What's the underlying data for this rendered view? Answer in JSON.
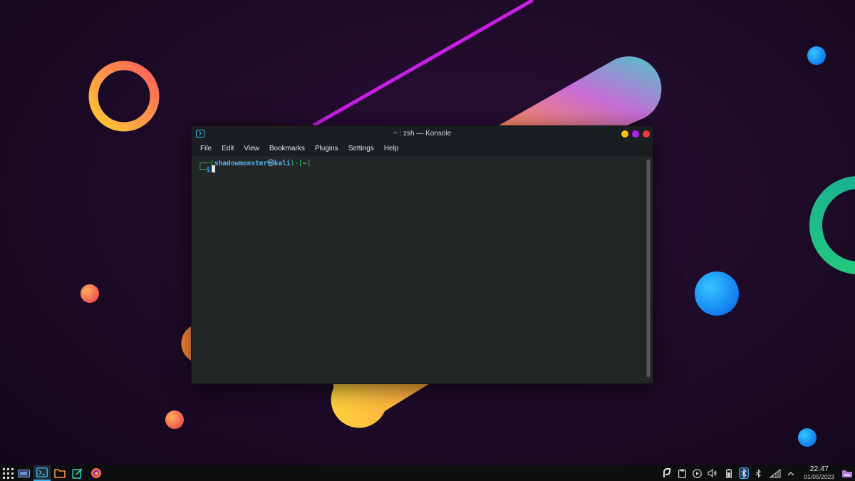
{
  "window": {
    "title": "~ : zsh — Konsole",
    "menu": [
      "File",
      "Edit",
      "View",
      "Bookmarks",
      "Plugins",
      "Settings",
      "Help"
    ]
  },
  "terminal": {
    "line1_prefix": "┌──(",
    "user": "shadowmonster",
    "at": "㉿",
    "host": "kali",
    "line1_mid": ")-[",
    "cwd": "~",
    "line1_end": "]",
    "line2_prefix": "└─",
    "prompt": "$"
  },
  "taskbar": {
    "icons": [
      "app-launcher-icon",
      "desktop-pager-icon",
      "konsole-icon",
      "file-manager-icon",
      "text-editor-icon",
      "firefox-icon"
    ],
    "tray_icons": [
      "vpn-icon",
      "clipboard-icon",
      "media-player-icon",
      "volume-icon",
      "battery-icon",
      "bluetooth-icon",
      "bluetooth-off-icon",
      "network-icon",
      "expand-tray-icon",
      "show-desktop-icon"
    ],
    "time": "22:47",
    "date": "01/05/2023"
  },
  "colors": {
    "accent": "#3daee9",
    "prompt_green": "#2fc25a",
    "prompt_blue": "#5ab1ee",
    "min_button": "#f5c211",
    "max_button": "#b31ff0",
    "close_button": "#f03838"
  }
}
